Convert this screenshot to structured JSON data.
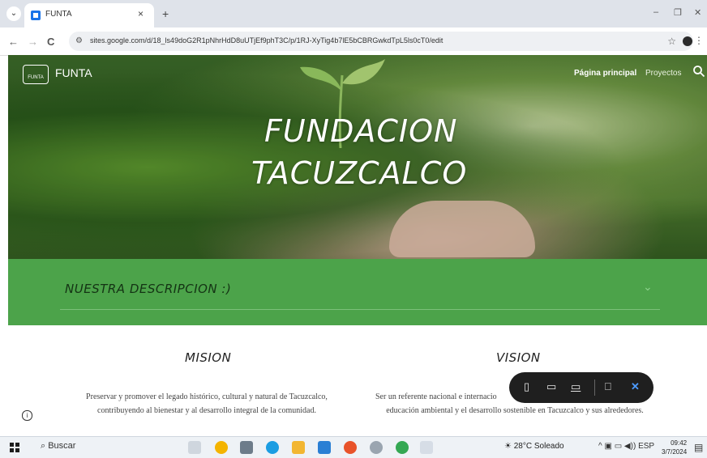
{
  "browser": {
    "tab_title": "FUNTA",
    "tab_close": "×",
    "new_tab": "+",
    "url": "sites.google.com/d/18_ls49doG2R1pNhrHdD8uUTjEf9phT3C/p/1RJ-XyTig4b7lE5bCBRGwkdTpL5ls0cT0/edit",
    "back": "←",
    "forward": "→",
    "reload": "C",
    "star": "☆",
    "more": "⋮",
    "minimize": "–",
    "restore": "❐",
    "close": "✕"
  },
  "site": {
    "logo_text": "FUNTA",
    "name": "FUNTA",
    "nav": {
      "home": "Página principal",
      "projects": "Proyectos"
    },
    "hero_title_line1": "FUNDACION",
    "hero_title_line2": "TACUZCALCO",
    "accordion_label": "NUESTRA DESCRIPCION :)",
    "chevron": "⌄"
  },
  "content": {
    "mision_title": "MISION",
    "mision_line1": "Preservar y promover el legado histórico, cultural y natural de Tacuzcalco,",
    "mision_line2": "contribuyendo al bienestar y al desarrollo integral de la comunidad.",
    "vision_title": "VISION",
    "vision_line1": "Ser un referente nacional e internacio",
    "vision_line2": "educación ambiental y el desarrollo sostenible en Tacuzcalco y sus alrededores.",
    "info": "i"
  },
  "taskbar": {
    "search": "Buscar",
    "weather": "28°C  Soleado",
    "tray": "ESP",
    "time": "09:42",
    "date": "3/7/2024"
  },
  "colors": {
    "band": "#4ca34a",
    "accent": "#1a73e8"
  }
}
